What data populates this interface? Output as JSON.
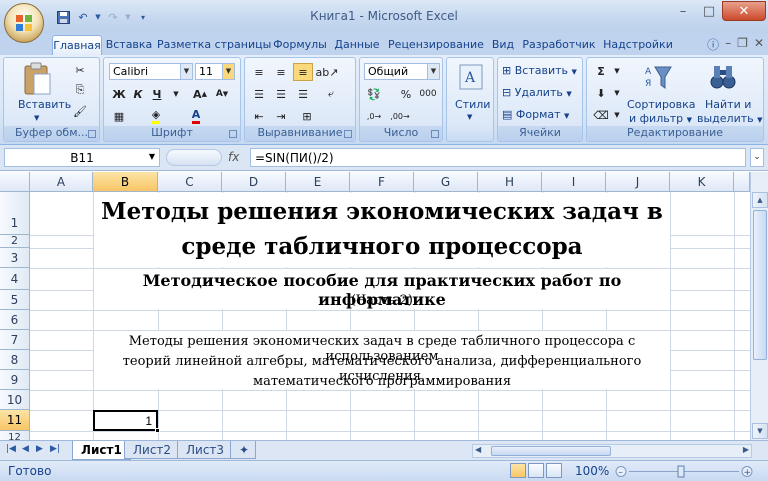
{
  "window": {
    "title": "Книга1 - Microsoft Excel"
  },
  "qat": {
    "save_icon": "save-icon",
    "undo_icon": "undo-icon",
    "redo_icon": "redo-icon",
    "customize_icon": "chevron-down-icon"
  },
  "tabs": [
    "Главная",
    "Вставка",
    "Разметка страницы",
    "Формулы",
    "Данные",
    "Рецензирование",
    "Вид",
    "Разработчик",
    "Надстройки"
  ],
  "ribbon": {
    "clipboard": {
      "paste_label": "Вставить",
      "group_label": "Буфер обм..."
    },
    "font": {
      "name": "Calibri",
      "size": "11",
      "group_label": "Шрифт"
    },
    "alignment": {
      "group_label": "Выравнивание"
    },
    "number": {
      "format": "Общий",
      "group_label": "Число"
    },
    "styles": {
      "label": "Стили"
    },
    "cells": {
      "insert": "Вставить",
      "delete": "Удалить",
      "format": "Формат",
      "group_label": "Ячейки"
    },
    "editing": {
      "sort_label_1": "Сортировка",
      "sort_label_2": "и фильтр",
      "find_label_1": "Найти и",
      "find_label_2": "выделить",
      "group_label": "Редактирование"
    }
  },
  "formula_bar": {
    "name_box": "B11",
    "fx": "fx",
    "formula": "=SIN(ПИ()/2)"
  },
  "columns": [
    "A",
    "B",
    "C",
    "D",
    "E",
    "F",
    "G",
    "H",
    "I",
    "J",
    "K"
  ],
  "rows": [
    "1",
    "2",
    "3",
    "4",
    "5",
    "6",
    "7",
    "8",
    "9",
    "10",
    "11",
    "12"
  ],
  "cells": {
    "title_line1": "Методы решения экономических задач в",
    "title_line2": "среде табличного процессора",
    "subtitle": "Методическое пособие для практических работ по информатике",
    "part": "(Часть 2)",
    "desc_line1": "Методы решения экономических задач в среде табличного процессора с использованием",
    "desc_line2": "теорий линейной алгебры, математического анализа, дифференциального исчисления,",
    "desc_line3": "математического программирования",
    "b11": "1"
  },
  "sheets": [
    "Лист1",
    "Лист2",
    "Лист3"
  ],
  "status": {
    "ready": "Готово",
    "zoom": "100%"
  }
}
